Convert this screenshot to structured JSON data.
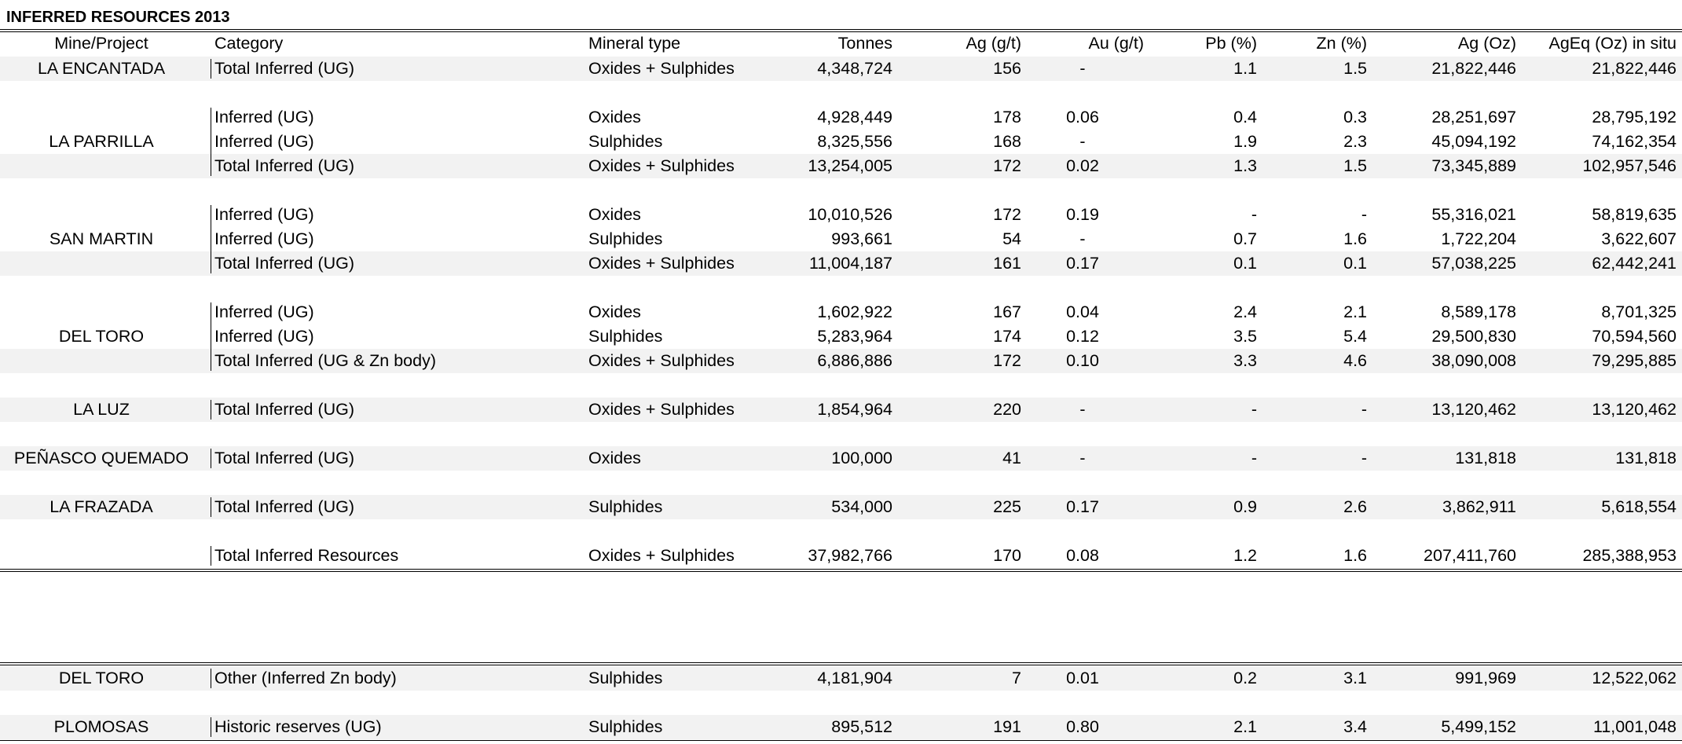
{
  "title": "INFERRED RESOURCES 2013",
  "columns": [
    "Mine/Project",
    "Category",
    "Mineral type",
    "Tonnes",
    "Ag (g/t)",
    "Au (g/t)",
    "Pb (%)",
    "Zn (%)",
    "Ag (Oz)",
    "AgEq (Oz) in situ"
  ],
  "groups": [
    {
      "mine": "LA ENCANTADA",
      "rows": [
        {
          "category": "Total Inferred (UG)",
          "mineral": "Oxides + Sulphides",
          "tonnes": "4,348,724",
          "ag": "156",
          "au": "-",
          "pb": "1.1",
          "zn": "1.5",
          "ag_oz": "21,822,446",
          "ageq": "21,822,446",
          "shaded": true
        }
      ]
    },
    {
      "mine": "LA PARRILLA",
      "rows": [
        {
          "category": "Inferred (UG)",
          "mineral": "Oxides",
          "tonnes": "4,928,449",
          "ag": "178",
          "au": "0.06",
          "pb": "0.4",
          "zn": "0.3",
          "ag_oz": "28,251,697",
          "ageq": "28,795,192",
          "shaded": false
        },
        {
          "category": "Inferred (UG)",
          "mineral": "Sulphides",
          "tonnes": "8,325,556",
          "ag": "168",
          "au": "-",
          "pb": "1.9",
          "zn": "2.3",
          "ag_oz": "45,094,192",
          "ageq": "74,162,354",
          "shaded": false
        },
        {
          "category": "Total Inferred (UG)",
          "mineral": "Oxides + Sulphides",
          "tonnes": "13,254,005",
          "ag": "172",
          "au": "0.02",
          "pb": "1.3",
          "zn": "1.5",
          "ag_oz": "73,345,889",
          "ageq": "102,957,546",
          "shaded": true
        }
      ]
    },
    {
      "mine": "SAN MARTIN",
      "rows": [
        {
          "category": "Inferred (UG)",
          "mineral": "Oxides",
          "tonnes": "10,010,526",
          "ag": "172",
          "au": "0.19",
          "pb": "-",
          "zn": "-",
          "ag_oz": "55,316,021",
          "ageq": "58,819,635",
          "shaded": false
        },
        {
          "category": "Inferred (UG)",
          "mineral": "Sulphides",
          "tonnes": "993,661",
          "ag": "54",
          "au": "-",
          "pb": "0.7",
          "zn": "1.6",
          "ag_oz": "1,722,204",
          "ageq": "3,622,607",
          "shaded": false
        },
        {
          "category": "Total Inferred (UG)",
          "mineral": "Oxides + Sulphides",
          "tonnes": "11,004,187",
          "ag": "161",
          "au": "0.17",
          "pb": "0.1",
          "zn": "0.1",
          "ag_oz": "57,038,225",
          "ageq": "62,442,241",
          "shaded": true
        }
      ]
    },
    {
      "mine": "DEL TORO",
      "rows": [
        {
          "category": "Inferred (UG)",
          "mineral": "Oxides",
          "tonnes": "1,602,922",
          "ag": "167",
          "au": "0.04",
          "pb": "2.4",
          "zn": "2.1",
          "ag_oz": "8,589,178",
          "ageq": "8,701,325",
          "shaded": false
        },
        {
          "category": "Inferred (UG)",
          "mineral": "Sulphides",
          "tonnes": "5,283,964",
          "ag": "174",
          "au": "0.12",
          "pb": "3.5",
          "zn": "5.4",
          "ag_oz": "29,500,830",
          "ageq": "70,594,560",
          "shaded": false
        },
        {
          "category": "Total Inferred (UG & Zn body)",
          "mineral": "Oxides + Sulphides",
          "tonnes": "6,886,886",
          "ag": "172",
          "au": "0.10",
          "pb": "3.3",
          "zn": "4.6",
          "ag_oz": "38,090,008",
          "ageq": "79,295,885",
          "shaded": true
        }
      ]
    },
    {
      "mine": "LA LUZ",
      "rows": [
        {
          "category": "Total Inferred (UG)",
          "mineral": "Oxides + Sulphides",
          "tonnes": "1,854,964",
          "ag": "220",
          "au": "-",
          "pb": "-",
          "zn": "-",
          "ag_oz": "13,120,462",
          "ageq": "13,120,462",
          "shaded": true
        }
      ]
    },
    {
      "mine": "PEÑASCO QUEMADO",
      "rows": [
        {
          "category": "Total Inferred (UG)",
          "mineral": "Oxides",
          "tonnes": "100,000",
          "ag": "41",
          "au": "-",
          "pb": "-",
          "zn": "-",
          "ag_oz": "131,818",
          "ageq": "131,818",
          "shaded": true
        }
      ]
    },
    {
      "mine": "LA FRAZADA",
      "rows": [
        {
          "category": "Total Inferred (UG)",
          "mineral": "Sulphides",
          "tonnes": "534,000",
          "ag": "225",
          "au": "0.17",
          "pb": "0.9",
          "zn": "2.6",
          "ag_oz": "3,862,911",
          "ageq": "5,618,554",
          "shaded": true
        }
      ]
    },
    {
      "mine": "",
      "rows": [
        {
          "category": "Total Inferred Resources",
          "mineral": "Oxides + Sulphides",
          "tonnes": "37,982,766",
          "ag": "170",
          "au": "0.08",
          "pb": "1.2",
          "zn": "1.6",
          "ag_oz": "207,411,760",
          "ageq": "285,388,953",
          "shaded": false
        }
      ]
    }
  ],
  "other": [
    {
      "mine": "DEL TORO",
      "rows": [
        {
          "category": "Other (Inferred Zn body)",
          "mineral": "Sulphides",
          "tonnes": "4,181,904",
          "ag": "7",
          "au": "0.01",
          "pb": "0.2",
          "zn": "3.1",
          "ag_oz": "991,969",
          "ageq": "12,522,062",
          "shaded": true
        }
      ]
    },
    {
      "mine": "PLOMOSAS",
      "rows": [
        {
          "category": "Historic reserves (UG)",
          "mineral": "Sulphides",
          "tonnes": "895,512",
          "ag": "191",
          "au": "0.80",
          "pb": "2.1",
          "zn": "3.4",
          "ag_oz": "5,499,152",
          "ageq": "11,001,048",
          "shaded": true
        }
      ]
    }
  ]
}
